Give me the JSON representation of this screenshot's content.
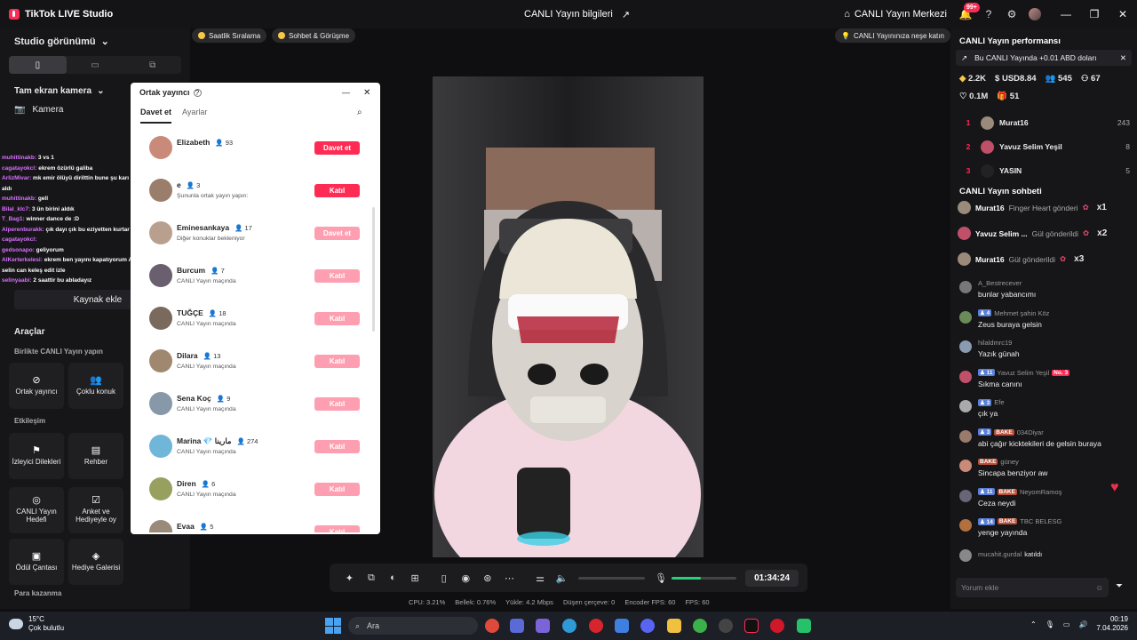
{
  "titlebar": {
    "app_name": "TikTok LIVE Studio",
    "live_info": "CANLI Yayın bilgileri",
    "live_center": "CANLI Yayın Merkezi",
    "notif_badge": "99+"
  },
  "left": {
    "studio_view": "Studio görünümü",
    "scene": "Tam ekran kamera",
    "camera": "Kamera",
    "add_source": "Kaynak ekle",
    "tools_title": "Araçlar",
    "section_together": "Birlikte CANLI Yayın yapın",
    "section_interaction": "Etkileşim",
    "section_earn": "Para kazanma",
    "tools": [
      "Ortak yayıncı",
      "Çoklu konuk",
      "İzleyici Dilekleri",
      "Rehber",
      "CANLI Yayın Hedefi",
      "Anket ve Hediyeyle oy",
      "Ödül Çantası",
      "Hediye Galerisi"
    ],
    "overlay_chat": [
      {
        "user": "muhittinakb:",
        "text": "3 vs 1"
      },
      {
        "user": "cagatayokcl:",
        "text": "ekrem özürlü galiba"
      },
      {
        "user": "ArlizMivar:",
        "text": "mk emir ölüyü dirilttin bune şu karı bile bir bir hediye aldı"
      },
      {
        "user": "muhittinakb:",
        "text": "gell"
      },
      {
        "user": "Bilal_klc7:",
        "text": "3 ün birini aldık"
      },
      {
        "user": "T_Bag1:",
        "text": "winner dance de :D"
      },
      {
        "user": "Alperenburakk:",
        "text": "çık dayı çık bu eziyetten kurtar"
      },
      {
        "user": "cagatayokcl:",
        "text": ""
      },
      {
        "user": "gedsonapo:",
        "text": "geliyorum"
      },
      {
        "user": "AlKerterkelesi:",
        "text": "ekrem ben yayını kapatıyorum Allah'a emanet. selin can keleş edit izle"
      },
      {
        "user": "selinyaabi:",
        "text": "2 saattir bu abladayız"
      }
    ]
  },
  "chips": {
    "hourly": "Saatlik Sıralama",
    "chat_meet": "Sohbet & Görüşme",
    "cheer": "CANLI Yayınınıza neşe katın"
  },
  "dialog": {
    "title": "Ortak yayıncı",
    "tab_invite": "Davet et",
    "tab_settings": "Ayarlar",
    "rows": [
      {
        "name": "Elizabeth",
        "count": "93",
        "sub": "",
        "btn": "Davet et",
        "active": true
      },
      {
        "name": "e",
        "count": "3",
        "sub": "Şununla ortak yayın yapın:",
        "btn": "Katıl",
        "active": true
      },
      {
        "name": "Eminesankaya",
        "count": "17",
        "sub": "Diğer konuklar bekleniyor",
        "btn": "Davet et",
        "active": false
      },
      {
        "name": "Burcum",
        "count": "7",
        "sub": "CANLI Yayın maçında",
        "btn": "Katıl",
        "active": false
      },
      {
        "name": "TUĞÇE",
        "count": "18",
        "sub": "CANLI Yayın maçında",
        "btn": "Katıl",
        "active": false
      },
      {
        "name": "Dilara",
        "count": "13",
        "sub": "CANLI Yayın maçında",
        "btn": "Katıl",
        "active": false
      },
      {
        "name": "Sena Koç",
        "count": "9",
        "sub": "CANLI Yayın maçında",
        "btn": "Katıl",
        "active": false
      },
      {
        "name": "Marina 💎 مارينا",
        "count": "274",
        "sub": "CANLI Yayın maçında",
        "btn": "Katıl",
        "active": false
      },
      {
        "name": "Diren",
        "count": "6",
        "sub": "CANLI Yayın maçında",
        "btn": "Katıl",
        "active": false
      },
      {
        "name": "Evaa",
        "count": "5",
        "sub": "",
        "btn": "Katıl",
        "active": false
      }
    ]
  },
  "controls": {
    "timer": "01:34:24",
    "volume_level": 0.45
  },
  "stats": {
    "cpu": "CPU: 3.21%",
    "memory": "Bellek: 0.76%",
    "upload": "Yükle: 4.2 Mbps",
    "drop": "Düşen çerçeve: 0",
    "encoder": "Encoder FPS: 60",
    "fps": "FPS: 60"
  },
  "right": {
    "perf_title": "CANLI Yayın performansı",
    "promo": "Bu CANLI Yayında +0.01 ABD doları",
    "metrics": {
      "diamonds": "2.2K",
      "usd": "USD8.84",
      "viewers": "545",
      "new": "67",
      "likes": "0.1M",
      "gifts": "51"
    },
    "ranking": [
      {
        "rank": "1",
        "name": "Murat16",
        "value": "243"
      },
      {
        "rank": "2",
        "name": "Yavuz Selim Yeşil",
        "value": "8"
      },
      {
        "rank": "3",
        "name": "YASIN",
        "value": "5"
      }
    ],
    "chat_title": "CANLI Yayın sohbeti",
    "gifts": [
      {
        "user": "Murat16",
        "text": "Finger Heart gönderi",
        "mult": "x1"
      },
      {
        "user": "Yavuz Selim ...",
        "text": "Gül gönderildi",
        "mult": "x2"
      },
      {
        "user": "Murat16",
        "text": "Gül gönderildi",
        "mult": "x3"
      }
    ],
    "messages": [
      {
        "user": "A_Bestrecever",
        "level": "",
        "bake": "",
        "text": "bunlar yabancımı"
      },
      {
        "user": "Mehmet şahin Köz",
        "level": "4",
        "bake": "",
        "text": "Zeus buraya gelsin"
      },
      {
        "user": "hilaldmrc19",
        "level": "",
        "bake": "",
        "text": "Yazık günah"
      },
      {
        "user": "Yavuz Selim Yeşil",
        "level": "11",
        "bake": "",
        "tag": "No. 3",
        "text": "Sıkma canını"
      },
      {
        "user": "Efe",
        "level": "3",
        "bake": "",
        "text": "çık ya"
      },
      {
        "user": "034Diyar",
        "level": "3",
        "bake": "BAKE",
        "text": "abi çağır kicktekileri de gelsin buraya"
      },
      {
        "user": "güney",
        "level": "",
        "bake": "BAKE",
        "text": "Sincapa benziyor aw"
      },
      {
        "user": "NeyomRamoş",
        "level": "11",
        "bake": "BAKE",
        "text": "Ceza neydi"
      },
      {
        "user": "TBC BELESG",
        "level": "14",
        "bake": "BAKE",
        "text": "yenge yayında"
      },
      {
        "user": "mucahit.gurdal",
        "level": "",
        "bake": "",
        "text": "katıldı"
      }
    ],
    "comment_placeholder": "Yorum ekle"
  },
  "taskbar": {
    "temp": "15°C",
    "weather": "Çok bulutlu",
    "search": "Ara",
    "time": "00:19",
    "date": "7.04.2026"
  }
}
